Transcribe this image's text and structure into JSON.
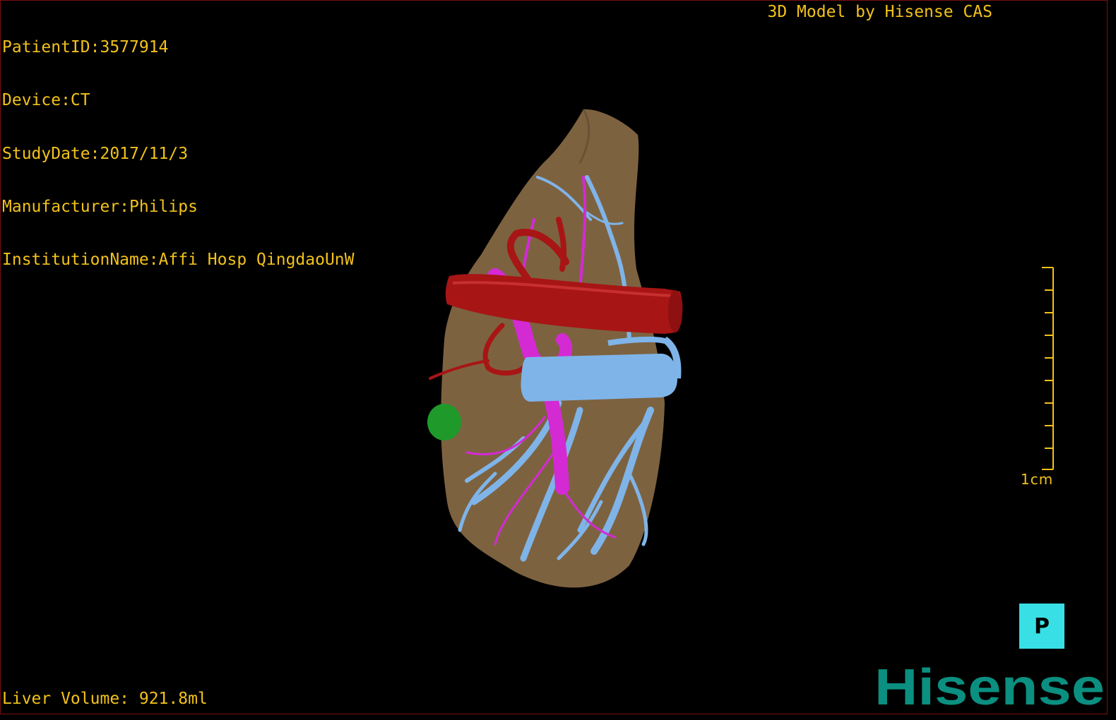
{
  "overlay": {
    "patient_id": "PatientID:3577914",
    "device": "Device:CT",
    "study_date": "StudyDate:2017/11/3",
    "manufacturer": "Manufacturer:Philips",
    "institution": "InstitutionName:Affi Hosp QingdaoUnW",
    "title": "3D Model by Hisense CAS",
    "liver_volume": "Liver Volume: 921.8ml"
  },
  "scale": {
    "label": "1cm"
  },
  "orientation": {
    "label": "P"
  },
  "brand": {
    "name": "Hisense"
  },
  "colors": {
    "background": "#000000",
    "overlay_text": "#f2c21b",
    "liver": "#7d6240",
    "artery": "#b01a1a",
    "portal_vein": "#d42ad4",
    "hepatic_vein": "#7fb4e8",
    "lesion": "#1f9a2a",
    "orientation_cube": "#38e0e6",
    "brand": "#0b8f80"
  }
}
